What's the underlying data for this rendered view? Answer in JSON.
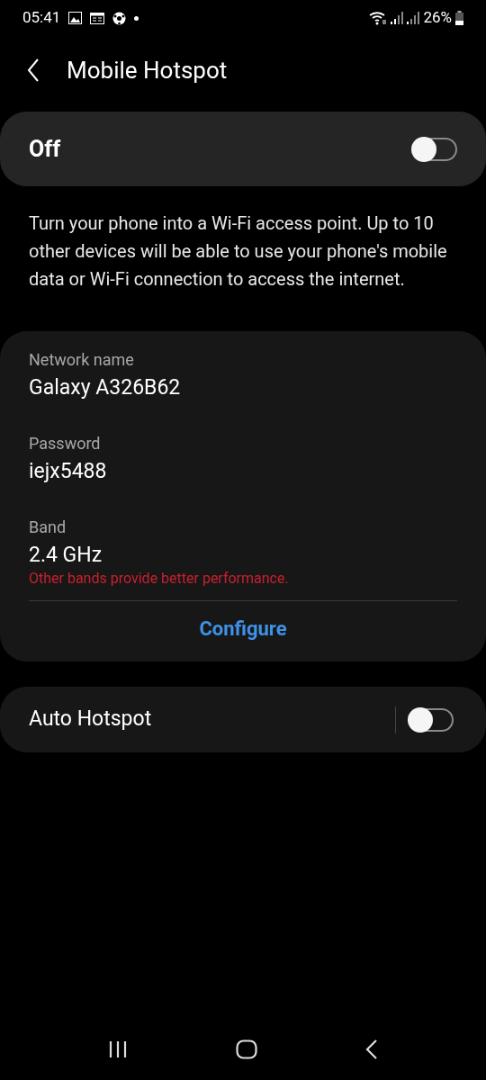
{
  "status_bar": {
    "time": "05:41",
    "battery": "26%"
  },
  "header": {
    "title": "Mobile Hotspot"
  },
  "master_switch": {
    "label": "Off",
    "on": false
  },
  "description": "Turn your phone into a Wi-Fi access point. Up to 10 other devices will be able to use your phone's mobile data or Wi-Fi connection to access the internet.",
  "settings": [
    {
      "label": "Network name",
      "value": "Galaxy A326B62"
    },
    {
      "label": "Password",
      "value": "iejx5488"
    },
    {
      "label": "Band",
      "value": "2.4 GHz",
      "warning": "Other bands provide better performance."
    }
  ],
  "configure_button": "Configure",
  "auto_hotspot": {
    "label": "Auto Hotspot",
    "on": false
  }
}
